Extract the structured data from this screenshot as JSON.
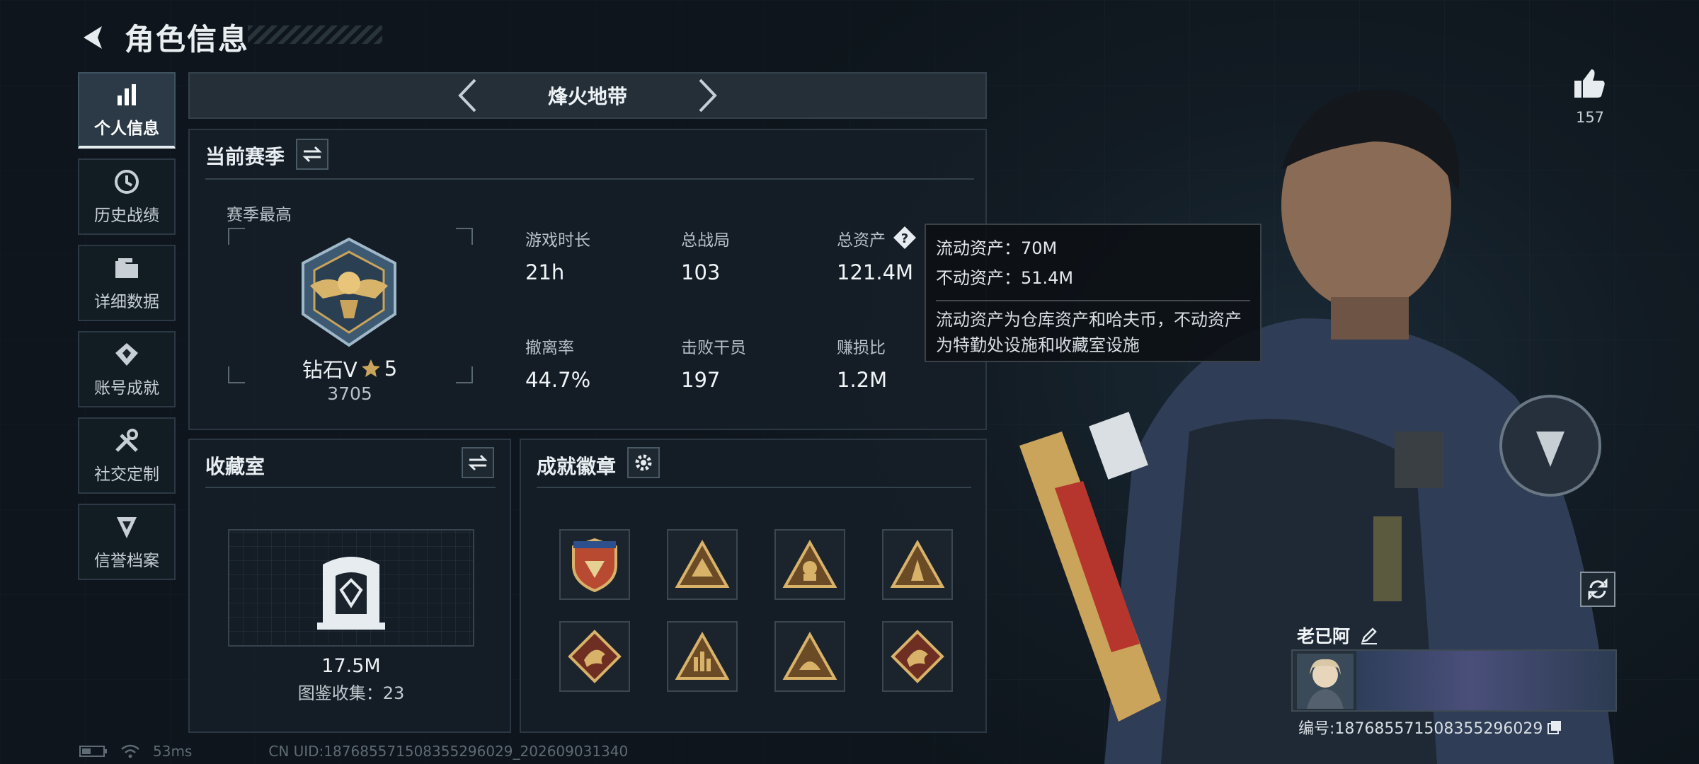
{
  "header": {
    "title": "角色信息"
  },
  "sidebar": {
    "items": [
      {
        "label": "个人信息",
        "icon": "bar-chart-icon",
        "active": true
      },
      {
        "label": "历史战绩",
        "icon": "history-clock-icon",
        "active": false
      },
      {
        "label": "详细数据",
        "icon": "folder-icon",
        "active": false
      },
      {
        "label": "账号成就",
        "icon": "achievement-icon",
        "active": false
      },
      {
        "label": "社交定制",
        "icon": "tools-icon",
        "active": false
      },
      {
        "label": "信誉档案",
        "icon": "reputation-shield-icon",
        "active": false
      }
    ]
  },
  "mode_selector": {
    "label": "烽火地带"
  },
  "season": {
    "title": "当前赛季",
    "highest_label": "赛季最高",
    "rank_name": "钻石V",
    "rank_stars": "5",
    "rank_score": "3705",
    "stats": [
      {
        "label": "游戏时长",
        "value": "21h"
      },
      {
        "label": "总战局",
        "value": "103"
      },
      {
        "label": "总资产",
        "value": "121.4M"
      },
      {
        "label": "撤离率",
        "value": "44.7%"
      },
      {
        "label": "击败干员",
        "value": "197"
      },
      {
        "label": "赚损比",
        "value": "1.2M"
      }
    ]
  },
  "tooltip": {
    "liquid": "流动资产：70M",
    "fixed": "不动资产：51.4M",
    "desc": "流动资产为仓库资产和哈夫币，不动资产为特勤处设施和收藏室设施"
  },
  "collection": {
    "title": "收藏室",
    "value": "17.5M",
    "catalog": "图鉴收集：23"
  },
  "achievements": {
    "title": "成就徽章",
    "badges": [
      "shield-badge",
      "triangle-badge-1",
      "triangle-badge-2",
      "triangle-badge-3",
      "dragon-badge-1",
      "hand-sign-badge",
      "triangle-badge-4",
      "dragon-badge-2"
    ]
  },
  "profile": {
    "likes": "157",
    "name": "老已阿",
    "id_label": "编号:18768557150835529602​9"
  },
  "footer": {
    "ping": "53ms",
    "uid": "CN UID:18768557150835529602​9_202609031340"
  },
  "colors": {
    "background": "#111820",
    "panel": "#161f27",
    "accent_gold": "#c9a45a",
    "text": "#d6dde3"
  }
}
